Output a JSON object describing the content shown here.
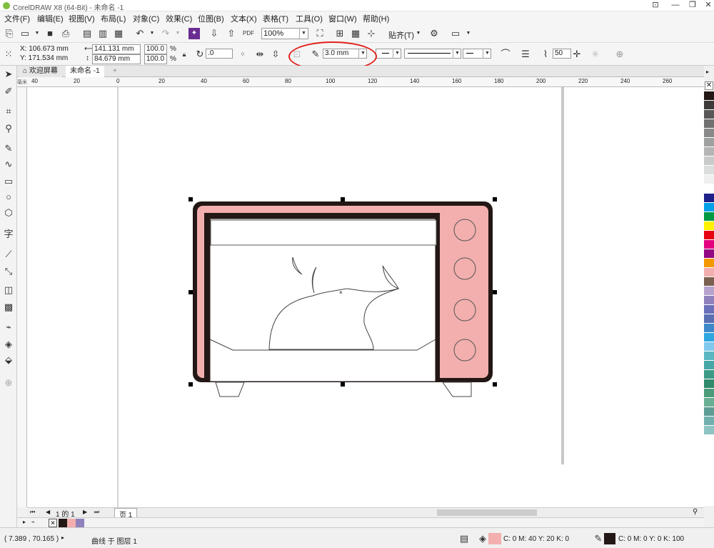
{
  "window": {
    "title": "CorelDRAW X8 (64-Bit) - 未命名 -1",
    "controls": [
      "⊡",
      "—",
      "❐",
      "✕"
    ]
  },
  "menu": [
    "文件(F)",
    "编辑(E)",
    "视图(V)",
    "布局(L)",
    "对象(C)",
    "效果(C)",
    "位图(B)",
    "文本(X)",
    "表格(T)",
    "工具(O)",
    "窗口(W)",
    "帮助(H)"
  ],
  "toolbar": {
    "zoom": "100%",
    "snap_label": "贴齐(T)"
  },
  "props": {
    "x": "X: 106.673 mm",
    "y": "Y: 171.534 mm",
    "width": "141.131 mm",
    "height": "84.679 mm",
    "scale_w": "100.0",
    "scale_h": "100.0",
    "pct": "%",
    "rotation": ".0",
    "outline_width": "3.0 mm",
    "smoothing": "50"
  },
  "tabs": {
    "welcome": "欢迎屏幕",
    "doc": "未命名 -1"
  },
  "ruler": {
    "h_ticks": [
      "40",
      "20",
      "0",
      "20",
      "40",
      "60",
      "80",
      "100",
      "120",
      "140",
      "160",
      "180",
      "200",
      "220",
      "240",
      "260"
    ],
    "h_unit": "毫米"
  },
  "page_nav": {
    "page_count": "1 的 1",
    "page_tab": "页 1"
  },
  "status": {
    "coords": "( 7.389 , 70.165 )",
    "info": "曲线 于 图层 1",
    "fill": "C: 0 M: 40 Y: 20 K: 0",
    "outline": "C: 0 M: 0 Y: 0 K: 100"
  },
  "colors": {
    "pink": "#f2afae",
    "black": "#231815",
    "annotation_red": "#e2211c",
    "palette": [
      "#231815",
      "#3e3a39",
      "#595757",
      "#727171",
      "#898989",
      "#9fa0a0",
      "#b5b5b6",
      "#c9caca",
      "#dcdddd",
      "#efefef",
      "#ffffff",
      "#1d2088",
      "#00a0e9",
      "#009944",
      "#fff100",
      "#e60012",
      "#e4007f",
      "#920783",
      "#f39800",
      "#f2afae",
      "#7b6052",
      "#b6a4cf",
      "#8f82bc",
      "#6a70b8",
      "#5a6fb2",
      "#3d88c9",
      "#2ea7e0",
      "#80c8ee",
      "#5bb7c2",
      "#47a6a6",
      "#3c9a86",
      "#2f8b6b",
      "#4d9c79",
      "#6aaf93",
      "#5e9c96",
      "#72b0ae",
      "#8ec4c2"
    ]
  }
}
